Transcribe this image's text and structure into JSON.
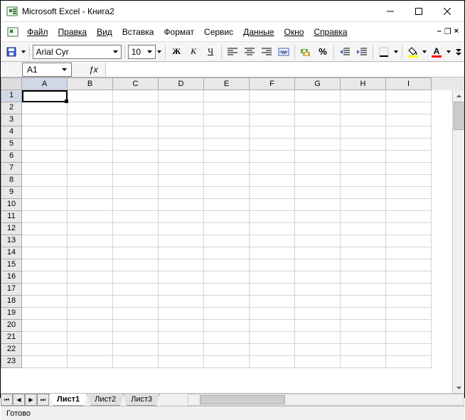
{
  "title": "Microsoft Excel - Книга2",
  "menu": {
    "file": "Файл",
    "edit": "Правка",
    "view": "Вид",
    "insert": "Вставка",
    "format": "Формат",
    "tools": "Сервис",
    "data": "Данные",
    "window": "Окно",
    "help": "Справка"
  },
  "toolbar": {
    "font": "Arial Cyr",
    "size": "10",
    "bold": "Ж",
    "italic": "К",
    "underline": "Ч",
    "percent": "%"
  },
  "namebox": "A1",
  "columns": [
    "A",
    "B",
    "C",
    "D",
    "E",
    "F",
    "G",
    "H",
    "I"
  ],
  "rows": [
    "1",
    "2",
    "3",
    "4",
    "5",
    "6",
    "7",
    "8",
    "9",
    "10",
    "11",
    "12",
    "13",
    "14",
    "15",
    "16",
    "17",
    "18",
    "19",
    "20",
    "21",
    "22",
    "23"
  ],
  "sheets": {
    "s1": "Лист1",
    "s2": "Лист2",
    "s3": "Лист3"
  },
  "status": "Готово",
  "selected_cell": "A1"
}
